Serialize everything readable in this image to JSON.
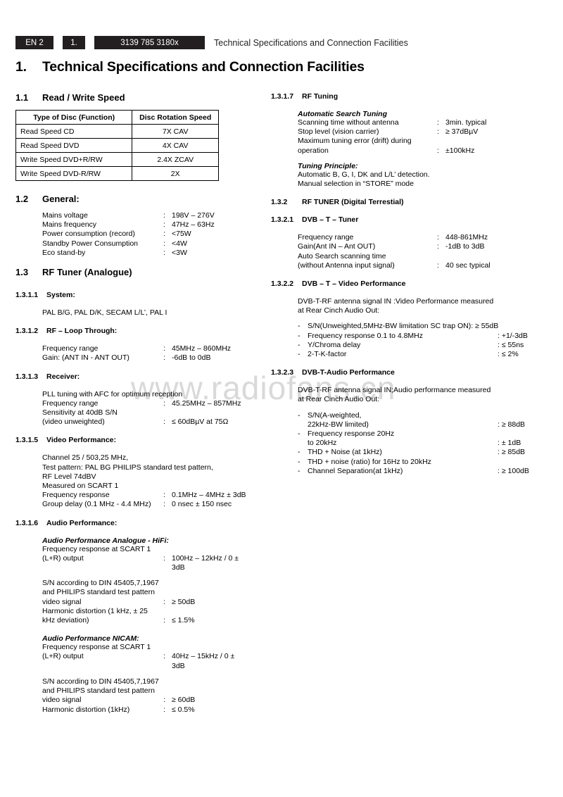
{
  "header": {
    "language_badge": "EN 2",
    "chapter_badge": "1.",
    "doc_code_badge": "3139 785 3180x",
    "running_title": "Technical Specifications and Connection Facilities"
  },
  "page_title": {
    "number": "1.",
    "text": "Technical Specifications and Connection Facilities"
  },
  "watermark": "www.radiofans.cn",
  "left_column": {
    "s11": {
      "number": "1.1",
      "title": "Read / Write Speed",
      "table": {
        "columns": [
          "Type of Disc (Function)",
          "Disc Rotation Speed"
        ],
        "rows": [
          [
            "Read Speed CD",
            "7X CAV"
          ],
          [
            "Read Speed DVD",
            "4X CAV"
          ],
          [
            "Write Speed DVD+R/RW",
            "2.4X ZCAV"
          ],
          [
            "Write Speed DVD-R/RW",
            "2X"
          ]
        ]
      }
    },
    "s12": {
      "number": "1.2",
      "title": "General:",
      "specs": [
        {
          "label": "Mains voltage",
          "value": "198V – 276V"
        },
        {
          "label": "Mains frequency",
          "value": "47Hz – 63Hz"
        },
        {
          "label": "Power consumption (record)",
          "value": "<75W"
        },
        {
          "label": "Standby Power Consumption",
          "value": "<4W"
        },
        {
          "label": "Eco stand-by",
          "value": "<3W"
        }
      ]
    },
    "s13": {
      "number": "1.3",
      "title": "RF Tuner (Analogue)"
    },
    "s1311": {
      "number": "1.3.1.1",
      "title": "System:",
      "lines": [
        "PAL B/G, PAL D/K, SECAM L/L’, PAL I"
      ]
    },
    "s1312": {
      "number": "1.3.1.2",
      "title": "RF – Loop Through:",
      "specs": [
        {
          "label": "Frequency range",
          "value": "45MHz – 860MHz"
        },
        {
          "label": "Gain: (ANT IN - ANT OUT)",
          "value": "-6dB to 0dB"
        }
      ]
    },
    "s1313": {
      "number": "1.3.1.3",
      "title": "Receiver:",
      "lines": [
        "PLL tuning with AFC for optimum reception"
      ],
      "specs": [
        {
          "label": "Frequency range",
          "value": "45.25MHz – 857MHz"
        },
        {
          "label": "Sensitivity at 40dB S/N",
          "value": ""
        },
        {
          "label": "(video unweighted)",
          "value": "≤ 60dBµV at 75Ω"
        }
      ]
    },
    "s1315": {
      "number": "1.3.1.5",
      "title": "Video Performance:",
      "lines": [
        "Channel 25 / 503,25 MHz,",
        "Test pattern: PAL BG PHILIPS standard test pattern,",
        "RF Level 74dBV",
        "Measured on SCART 1"
      ],
      "specs": [
        {
          "label": "Frequency response",
          "value": "0.1MHz – 4MHz ± 3dB"
        },
        {
          "label": "Group delay (0.1 MHz - 4.4 MHz)",
          "value": "0 nsec ± 150 nsec"
        }
      ]
    },
    "s1316": {
      "number": "1.3.1.6",
      "title": "Audio Performance:",
      "hifi": {
        "heading": "Audio Performance Analogue - HiFi:",
        "lines": [
          "Frequency response at SCART 1"
        ],
        "specs": [
          {
            "label": "(L+R) output",
            "value": "100Hz – 12kHz / 0 ±",
            "value2": "3dB"
          },
          {
            "label": "S/N according to DIN 45405,7,1967",
            "value": ""
          },
          {
            "label": "and PHILIPS standard test pattern",
            "value": ""
          },
          {
            "label": "video signal",
            "value": "≥ 50dB"
          },
          {
            "label": "Harmonic distortion (1 kHz, ± 25",
            "value": ""
          },
          {
            "label": "kHz deviation)",
            "value": "≤ 1.5%"
          }
        ]
      },
      "nicam": {
        "heading": "Audio Performance NICAM:",
        "lines": [
          "Frequency response at SCART 1"
        ],
        "specs": [
          {
            "label": "(L+R) output",
            "value": "40Hz – 15kHz / 0 ±",
            "value2": "3dB"
          },
          {
            "label": "S/N according to DIN 45405,7,1967",
            "value": ""
          },
          {
            "label": "and PHILIPS standard test pattern",
            "value": ""
          },
          {
            "label": "video signal",
            "value": "≥ 60dB"
          },
          {
            "label": "Harmonic distortion (1kHz)",
            "value": "≤ 0.5%"
          }
        ]
      }
    }
  },
  "right_column": {
    "s1317": {
      "number": "1.3.1.7",
      "title": "RF Tuning",
      "search_heading": "Automatic Search Tuning",
      "search_specs": [
        {
          "label": "Scanning time without antenna",
          "value": "3min. typical"
        },
        {
          "label": "Stop level (vision carrier)",
          "value": "≥ 37dBµV"
        },
        {
          "label": "Maximum tuning error (drift) during",
          "value": ""
        },
        {
          "label": "operation",
          "value": "±100kHz"
        }
      ],
      "principle_heading": "Tuning Principle:",
      "principle_lines": [
        "Automatic B, G, I, DK and L/L’ detection.",
        "Manual selection in “STORE” mode"
      ]
    },
    "s132": {
      "number": "1.3.2",
      "title": "RF TUNER (Digital Terrestial)"
    },
    "s1321": {
      "number": "1.3.2.1",
      "title": "DVB – T – Tuner",
      "specs": [
        {
          "label": "Frequency range",
          "value": "448-861MHz"
        },
        {
          "label": "Gain(Ant IN – Ant OUT)",
          "value": "-1dB to 3dB"
        },
        {
          "label": "Auto Search scanning time",
          "value": ""
        },
        {
          "label": "(without Antenna input signal)",
          "value": "40 sec typical"
        }
      ]
    },
    "s1322": {
      "number": "1.3.2.2",
      "title": "DVB – T – Video Performance",
      "intro": [
        "DVB-T-RF antenna signal IN :Video Performance measured",
        "at Rear Cinch Audio Out:"
      ],
      "bullets": [
        {
          "text": "S/N(Unweighted,5MHz-BW limitation SC trap ON): ≥ 55dB",
          "value": "",
          "wide": true
        },
        {
          "text": "Frequency response 0.1 to 4.8MHz",
          "value": ": +1/-3dB",
          "wide": false
        },
        {
          "text": "Y/Chroma delay",
          "value": ": ≤ 55ns",
          "wide": false
        },
        {
          "text": "2-T-K-factor",
          "value": ": ≤ 2%",
          "wide": false
        }
      ]
    },
    "s1323": {
      "number": "1.3.2.3",
      "title": "DVB-T-Audio Performance",
      "intro": [
        "DVB-T-RF antenna signal IN;Audio performance measured",
        "at Rear Cinch Audio Out:"
      ],
      "bullets": [
        {
          "text": "S/N(A-weighted,",
          "value": "",
          "wide": false
        },
        {
          "text": "22kHz-BW limited)",
          "value": ": ≥ 88dB",
          "wide": false,
          "cont": true
        },
        {
          "text": "Frequency response 20Hz",
          "value": "",
          "wide": false
        },
        {
          "text": "to 20kHz",
          "value": ": ± 1dB",
          "wide": false,
          "cont": true
        },
        {
          "text": "THD + Noise (at 1kHz)",
          "value": ": ≥ 85dB",
          "wide": false
        },
        {
          "text": "THD + noise (ratio) for 16Hz to 20kHz",
          "value": "",
          "wide": false
        },
        {
          "text": "Channel Separation(at 1kHz)",
          "value": ": ≥ 100dB",
          "wide": false
        }
      ]
    }
  }
}
